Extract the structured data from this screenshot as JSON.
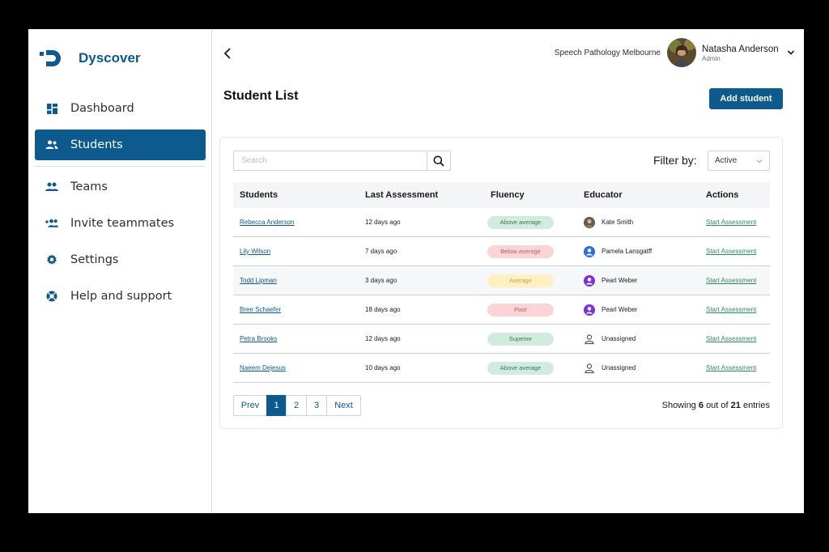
{
  "brand": {
    "name": "Dyscover",
    "color": "#0d5a8e"
  },
  "sidebar": {
    "items": [
      {
        "label": "Dashboard",
        "icon": "dashboard-icon"
      },
      {
        "label": "Students",
        "icon": "students-icon",
        "active": true
      },
      {
        "label": "Teams",
        "icon": "teams-icon"
      },
      {
        "label": "Invite teammates",
        "icon": "invite-icon"
      },
      {
        "label": "Settings",
        "icon": "gear-icon"
      },
      {
        "label": "Help and support",
        "icon": "help-icon"
      }
    ]
  },
  "header": {
    "organization": "Speech Pathology Melbourne",
    "user_name": "Natasha Anderson",
    "user_role": "Admin"
  },
  "page": {
    "title": "Student List",
    "add_button": "Add student"
  },
  "search": {
    "placeholder": "Search"
  },
  "filter": {
    "label": "Filter by:",
    "value": "Active"
  },
  "table": {
    "headers": {
      "students": "Students",
      "last_assessment": "Last Assessment",
      "fluency": "Fluency",
      "educator": "Educator",
      "actions": "Actions"
    },
    "rows": [
      {
        "student": "Rebecca Anderson",
        "last": "12 days ago",
        "fluency": "Above average",
        "educator": "Kate Smith",
        "action": "Start Assessment"
      },
      {
        "student": "Lily Wilson",
        "last": "7 days ago",
        "fluency": "Below average",
        "educator": "Pamela Lansgatff",
        "action": "Start Assessment"
      },
      {
        "student": "Todd Lipman",
        "last": "3 days ago",
        "fluency": "Average",
        "educator": "Pearl Weber",
        "action": "Start Assessment"
      },
      {
        "student": "Bree Schaefer",
        "last": "18 days ago",
        "fluency": "Poor",
        "educator": "Pearl Weber",
        "action": "Start Assessment"
      },
      {
        "student": "Petra Brooks",
        "last": "12 days ago",
        "fluency": "Superior",
        "educator": "Unassigned",
        "action": "Start Assessment"
      },
      {
        "student": "Naeem Dejesus",
        "last": "10 days ago",
        "fluency": "Above average",
        "educator": "Unassigned",
        "action": "Start Assessment"
      }
    ]
  },
  "pagination": {
    "prev": "Prev",
    "pages": [
      "1",
      "2",
      "3"
    ],
    "next": "Next",
    "showing_prefix": "Showing",
    "showing_count": "6",
    "showing_mid": "out of",
    "showing_total": "21",
    "showing_suffix": "entries"
  },
  "colors": {
    "primary": "#0d5a8e",
    "action_green": "#2f8f5b",
    "badge_green_bg": "#d3ebdf",
    "badge_red_bg": "#fbd4d8",
    "badge_yellow_bg": "#fff0c2"
  }
}
